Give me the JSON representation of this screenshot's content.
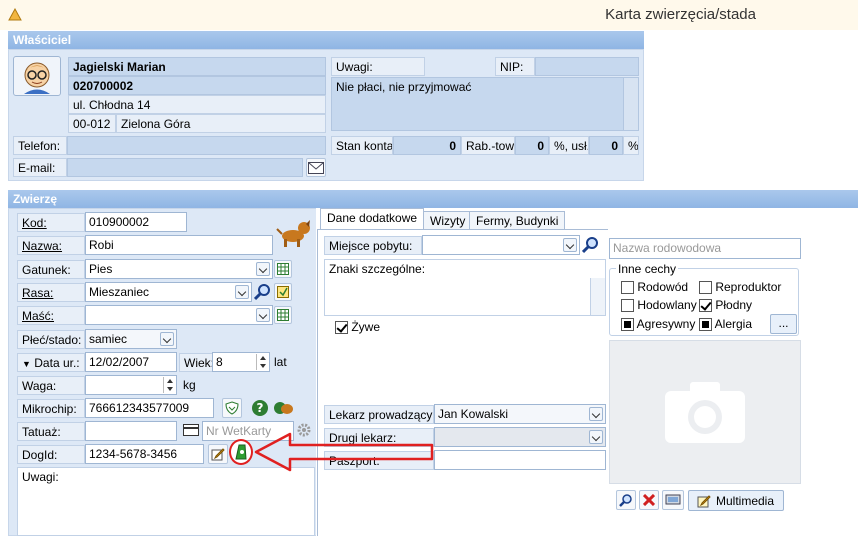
{
  "window": {
    "title": "Karta zwierzęcia/stada"
  },
  "owner": {
    "section_title": "Właściciel",
    "name": "Jagielski Marian",
    "id": "020700002",
    "street": "ul. Chłodna 14",
    "postal": "00-012",
    "city": "Zielona Góra",
    "notes_label": "Uwagi:",
    "nip_label": "NIP:",
    "nip_value": "",
    "notes_value": "Nie płaci, nie przyjmować",
    "phone_label": "Telefon:",
    "phone_value": "",
    "email_label": "E-mail:",
    "email_value": "",
    "balance_label": "Stan konta:",
    "balance_value": "0",
    "discount_goods_label": "Rab.-tow.",
    "discount_goods_value": "0",
    "pct_label": "%, usł.:",
    "discount_services_value": "0",
    "pct2_label": "%"
  },
  "animal": {
    "section_title": "Zwierzę",
    "code_label": "Kod:",
    "code": "010900002",
    "name_label": "Nazwa:",
    "name": "Robi",
    "species_label": "Gatunek:",
    "species": "Pies",
    "breed_label": "Rasa:",
    "breed": "Mieszaniec",
    "color_label": "Maść:",
    "color": "",
    "sex_label": "Płeć/stado:",
    "sex": "samiec",
    "dob_label": "Data ur.:",
    "dob": "12/02/2007",
    "age_label": "Wiek:",
    "age": "8",
    "age_unit": "lat",
    "weight_label": "Waga:",
    "weight": "",
    "weight_unit": "kg",
    "chip_label": "Mikrochip:",
    "chip": "766612343577009",
    "tattoo_label": "Tatuaż:",
    "tattoo": "",
    "wetcard_placeholder": "Nr WetKarty",
    "dogid_label": "DogId:",
    "dogid": "1234-5678-3456",
    "notes_label": "Uwagi:"
  },
  "tabs": [
    {
      "label": "Dane dodatkowe"
    },
    {
      "label": "Wizyty"
    },
    {
      "label": "Fermy, Budynki"
    }
  ],
  "extra": {
    "residence_label": "Miejsce pobytu:",
    "residence": "",
    "marks_label": "Znaki szczególne:",
    "alive_label": "Żywe",
    "vet_label": "Lekarz prowadzący:",
    "vet": "Jan Kowalski",
    "vet2_label": "Drugi lekarz:",
    "vet2": "",
    "passport_label": "Paszport:",
    "passport": ""
  },
  "right": {
    "pedigree_placeholder": "Nazwa rodowodowa",
    "traits_title": "Inne cechy",
    "trait_pedigree": "Rodowód",
    "trait_breeder": "Reproduktor",
    "trait_hodowlany": "Hodowlany",
    "trait_fertile": "Płodny",
    "trait_aggressive": "Agresywny",
    "trait_allergy": "Alergia",
    "more_button": "...",
    "multimedia_button": "Multimedia"
  },
  "colors": {
    "header": "#8fb5e4",
    "panel": "#dde8f6",
    "arrow": "#e02020"
  }
}
